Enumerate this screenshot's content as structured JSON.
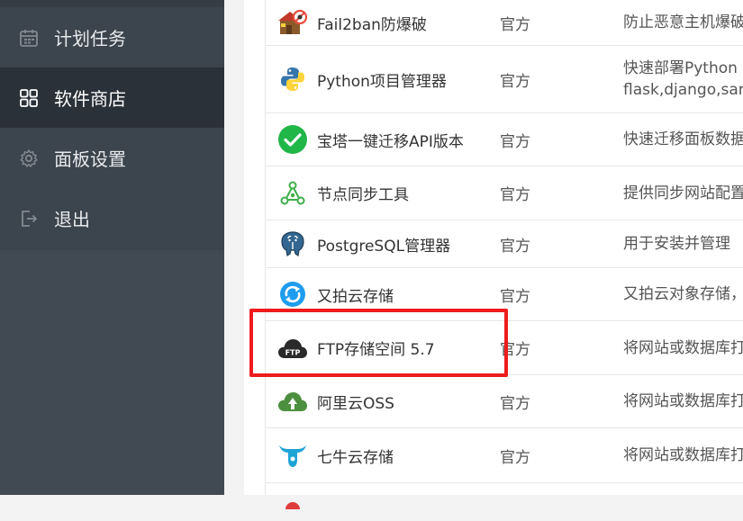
{
  "sidebar": {
    "items": [
      {
        "label": "计划任务",
        "icon": "calendar-icon",
        "active": false
      },
      {
        "label": "软件商店",
        "icon": "apps-grid-icon",
        "active": true
      },
      {
        "label": "面板设置",
        "icon": "gear-icon",
        "active": false
      },
      {
        "label": "退出",
        "icon": "logout-icon",
        "active": false
      }
    ]
  },
  "plugins": [
    {
      "name": "Fail2ban防爆破",
      "type": "官方",
      "desc": "防止恶意主机爆破",
      "desc2": "",
      "icon": "fail2ban-icon"
    },
    {
      "name": "Python项目管理器",
      "type": "官方",
      "desc": "快速部署Python",
      "desc2": "flask,django,sar",
      "icon": "python-icon"
    },
    {
      "name": "宝塔一键迁移API版本",
      "type": "官方",
      "desc": "快速迁移面板数据",
      "desc2": "",
      "icon": "check-circle-icon"
    },
    {
      "name": "节点同步工具",
      "type": "官方",
      "desc": "提供同步网站配置",
      "desc2": "",
      "icon": "node-sync-icon"
    },
    {
      "name": "PostgreSQL管理器",
      "type": "官方",
      "desc": "用于安装并管理",
      "desc2": "",
      "icon": "postgresql-icon"
    },
    {
      "name": "又拍云存储",
      "type": "官方",
      "desc": "又拍云对象存储，",
      "desc2": "",
      "icon": "upyun-icon"
    },
    {
      "name": "FTP存储空间 5.7",
      "type": "官方",
      "desc": "将网站或数据库打",
      "desc2": "",
      "icon": "ftp-cloud-icon"
    },
    {
      "name": "阿里云OSS",
      "type": "官方",
      "desc": "将网站或数据库打",
      "desc2": "",
      "icon": "aliyun-oss-icon"
    },
    {
      "name": "七牛云存储",
      "type": "官方",
      "desc": "将网站或数据库打",
      "desc2": "",
      "icon": "qiniu-icon"
    }
  ],
  "colors": {
    "sidebar": "#3c444d",
    "sidebar_active": "#2b3138",
    "highlight": "#ee1c1c"
  }
}
